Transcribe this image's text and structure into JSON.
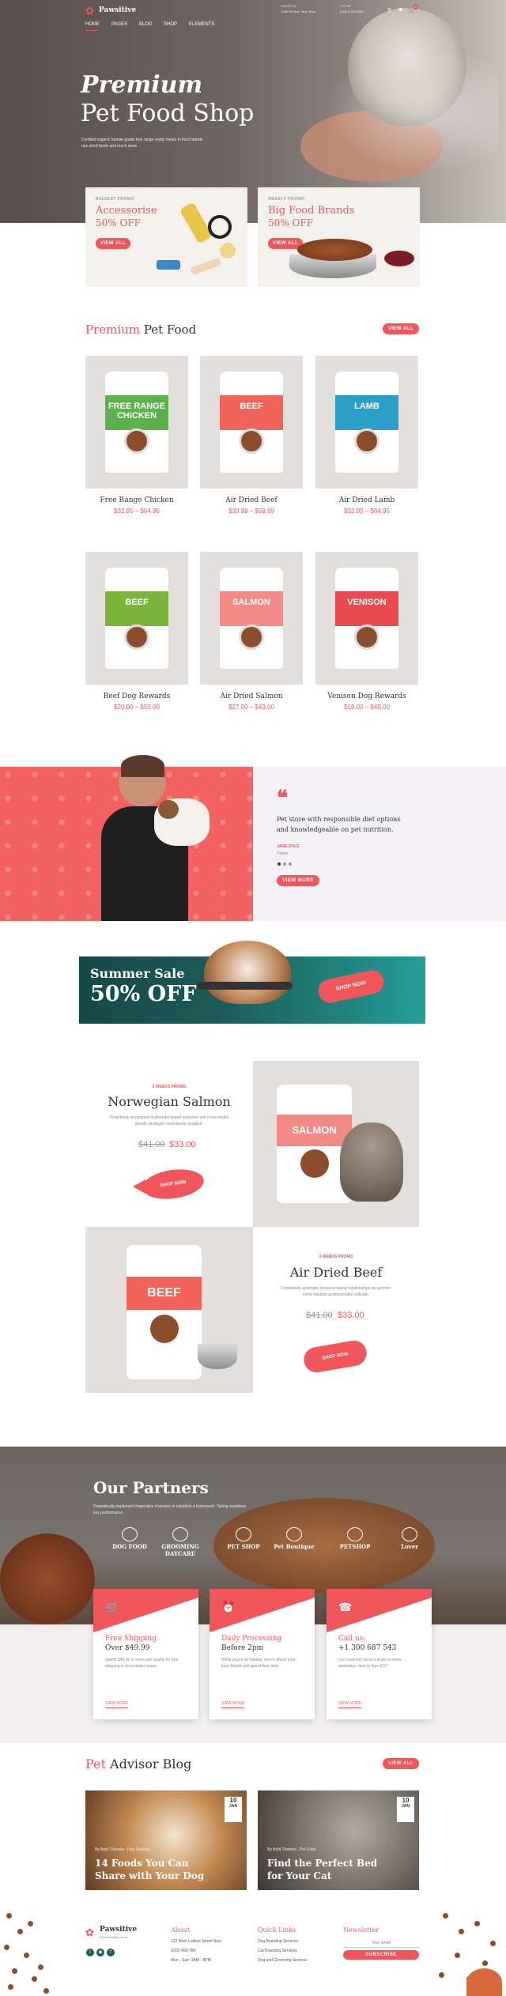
{
  "brand": {
    "name": "Pawsitive",
    "tagline": "Pet Boarding Center"
  },
  "nav": {
    "items": [
      "HOME",
      "PAGES",
      "BLOG",
      "SHOP",
      "ELEMENTS"
    ]
  },
  "header_info": {
    "address_label": "ADDRESS",
    "address_value": "1238 Pet Ave, Your Town",
    "phone_label": "PHONE",
    "phone_value": "(222) 5 123-4567",
    "cart_count": "0"
  },
  "hero": {
    "title_italic": "Premium",
    "title_rest": "Pet Food Shop",
    "subtitle": "Certified organic human grade free range ready meals to food brands raw dried foods and much more"
  },
  "promos": [
    {
      "label": "BIGGEST PROMO",
      "line1": "Accessorise",
      "line2": "50% OFF",
      "button": "VIEW ALL"
    },
    {
      "label": "WEEKLY PROMO",
      "line1": "Big Food Brands",
      "line2": "50% OFF",
      "button": "VIEW ALL"
    }
  ],
  "premium_section": {
    "title_red": "Premium",
    "title_rest": "Pet Food",
    "button": "VIEW ALL"
  },
  "products": [
    {
      "name": "Free Range Chicken",
      "price": "$32.95 – $64.95",
      "bag": "FREE RANGE CHICKEN",
      "color": "#5bb14a"
    },
    {
      "name": "Air Dried Beef",
      "price": "$30.99 – $59.99",
      "bag": "BEEF",
      "color": "#f0645a"
    },
    {
      "name": "Air Dried Lamb",
      "price": "$32.95 – $64.95",
      "bag": "LAMB",
      "color": "#2aa0c8"
    },
    {
      "name": "Beef Dog Rewards",
      "price": "$20.00 – $55.00",
      "bag": "BEEF",
      "color": "#7ab43a"
    },
    {
      "name": "Air Dried Salmon",
      "price": "$27.00 – $43.00",
      "bag": "SALMON",
      "color": "#f28b86"
    },
    {
      "name": "Venison Dog Rewards",
      "price": "$18.00 – $45.00",
      "bag": "VENISON",
      "color": "#e84a50"
    }
  ],
  "testimonial": {
    "quote": "Pet store with responsible diet options and knowledgeable on pet nutrition.",
    "author": "JANE DOLE",
    "role": "Owner",
    "button": "VIEW MORE"
  },
  "sale_banner": {
    "line1": "Summer Sale",
    "line2": "50% OFF",
    "button": "SHOP NOW"
  },
  "featured": [
    {
      "label": "2 WEEKS PROMO",
      "name": "Norwegian Salmon",
      "desc": "Proactively envisioned multimedia based expertise and cross-media growth strategies seamlessly visualize.",
      "old_price": "$41.00",
      "new_price": "$33.00",
      "button": "SHOP NOW"
    },
    {
      "label": "2 WEEKS PROMO",
      "name": "Air Dried Beef",
      "desc": "Completely synergize resource taxing relationships via premier niche markets professionally cultivate.",
      "old_price": "$41.00",
      "new_price": "$33.00",
      "button": "SHOP NOW"
    }
  ],
  "partners": {
    "title": "Our Partners",
    "desc": "Dramatically implement imperative channels to establish a framework. Taking seamless key performance.",
    "logos": [
      "DOG FOOD",
      "GROOMING DAYCARE",
      "PET SHOP",
      "Pet Boutique",
      "PETSHOP",
      "Lover"
    ]
  },
  "features": [
    {
      "icon": "cart-icon",
      "title_red": "Free Shipping",
      "title_rest": "Over $49.99",
      "desc": "Spend $49.99 or more and qualify for free shipping in most states areas.",
      "link": "VIEW MORE"
    },
    {
      "icon": "alarm-icon",
      "title_red": "Daily Processing",
      "title_rest": "Before 2pm",
      "desc": "While you're on holiday, here's where your furry friends will spend their time.",
      "link": "VIEW MORE"
    },
    {
      "icon": "phone-icon",
      "title_red": "Call us:",
      "title_rest": "+1 300 687 543",
      "desc": "Our customer service team is online weekdays, 9am to 4pm EST.",
      "link": "VIEW MORE"
    }
  ],
  "blog": {
    "title_red": "Pet",
    "title_rest": "Advisor Blog",
    "button": "VIEW ALL",
    "posts": [
      {
        "day": "10",
        "month": "JAN",
        "meta": "By Bold Themes  ·  Dog Nutrition",
        "title": "14 Foods You Can Share with Your Dog"
      },
      {
        "day": "10",
        "month": "JAN",
        "meta": "By Bold Themes  ·  Pet Food",
        "title": "Find the Perfect Bed for Your Cat"
      }
    ]
  },
  "footer": {
    "about": {
      "title": "About",
      "address": "123 Main Ludlow Street New",
      "phone": "(222) 456-789",
      "hours": "Mon - Sun: 9AM - 8PM"
    },
    "links": {
      "title": "Quick Links",
      "items": [
        "Dog Boarding Services",
        "Cat Boarding Services",
        "Dog and Grooming Services"
      ]
    },
    "newsletter": {
      "title": "Newsletter",
      "placeholder": "Your email",
      "button": "SUBSCRIBE"
    }
  }
}
